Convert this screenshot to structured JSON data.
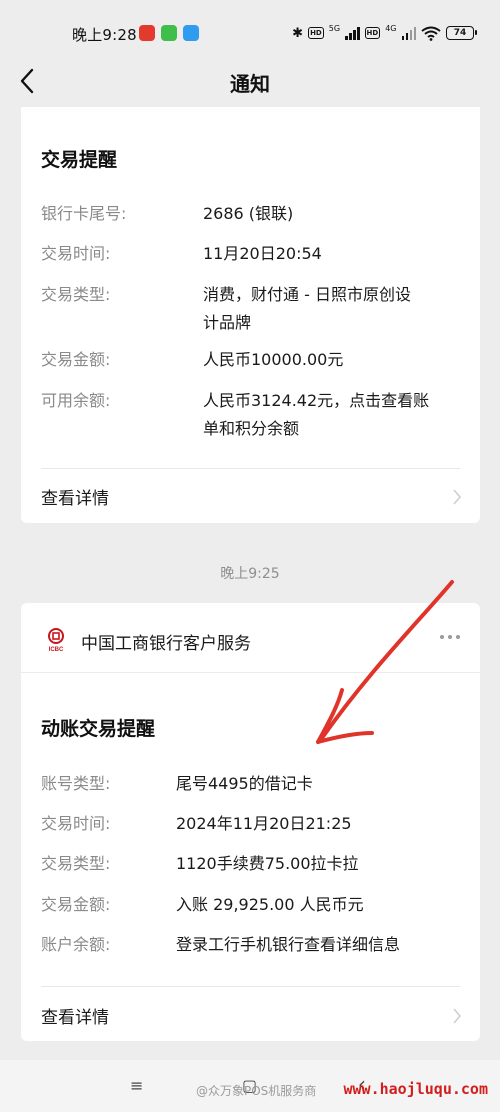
{
  "status_bar": {
    "time": "晚上9:28",
    "network_1": "5G",
    "network_2": "4G",
    "battery": "74",
    "icons": [
      "notification-app-icon",
      "notification-app-icon",
      "notification-app-icon",
      "bluetooth-icon",
      "hd-icon",
      "signal-icon",
      "hd-icon",
      "signal-icon",
      "wifi-icon",
      "battery-icon"
    ]
  },
  "header": {
    "title": "通知",
    "back_icon": "chevron-left-icon"
  },
  "message1": {
    "title": "交易提醒",
    "rows": [
      {
        "label": "银行卡尾号:",
        "value": "2686 (银联)"
      },
      {
        "label": "交易时间:",
        "value": "11月20日20:54"
      },
      {
        "label": "交易类型:",
        "value_line1": "消费，财付通 - 日照市原创设",
        "value_line2": "计品牌"
      },
      {
        "label": "交易金额:",
        "value": "人民币10000.00元"
      },
      {
        "label": "可用余额:",
        "value_line1": "人民币3124.42元，点击查看账",
        "value_line2": "单和积分余额"
      }
    ],
    "detail_label": "查看详情"
  },
  "timestamp": "晚上9:25",
  "message2": {
    "sender": "中国工商银行客户服务",
    "logo_text": "ICBC",
    "title": "动账交易提醒",
    "rows": [
      {
        "label": "账号类型:",
        "value": "尾号4495的借记卡"
      },
      {
        "label": "交易时间:",
        "value": "2024年11月20日21:25"
      },
      {
        "label": "交易类型:",
        "value": "1120手续费75.00拉卡拉"
      },
      {
        "label": "交易金额:",
        "value": "入账 29,925.00 人民币元"
      },
      {
        "label": "账户余额:",
        "value": "登录工行手机银行查看详细信息"
      }
    ],
    "detail_label": "查看详情"
  },
  "bottom": {
    "menu_glyph": "≡",
    "home_glyph": "▢",
    "back_glyph": "‹",
    "watermark": "@众万象POS机服务商",
    "site": "www.haojluqu.com"
  },
  "colors": {
    "background": "#ededed",
    "card": "#ffffff",
    "label": "#8a8a8a",
    "annotation_arrow": "#e0342a"
  }
}
